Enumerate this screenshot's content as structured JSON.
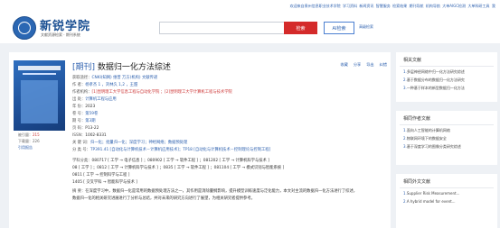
{
  "topnav": [
    "欢迎来自泉州信息职业技术学院",
    "学习资料",
    "新闻资讯",
    "智慧服务",
    "检索结果",
    "期刊导航",
    "机构导航",
    "大单AIGC检测",
    "大单科研工具",
    "我"
  ],
  "header": {
    "logo_title": "新锐学院",
    "logo_sub": "文献资源检索 · 期刊系统",
    "search_placeholder": "",
    "search_label": "检索",
    "ai_label": "AI检索",
    "advanced_label": "高级检索"
  },
  "article": {
    "type_tag": "[期刊]",
    "title": "数据归一化方法综述",
    "actions": [
      "收藏",
      "分享",
      "导出",
      "纠错"
    ],
    "rows": [
      {
        "label": "获取途径：",
        "value": "CNKI(知网)   维普   万方(机构)   文献传递"
      },
      {
        "label": "作 者：",
        "value": "杨孝杰 1 ，刘林久 1,2 ，王甜"
      },
      {
        "label": "作者机构：",
        "value": "[1]昆明理工大学信息工程与自动化学院 ；[2]昆明理工大学计算机工程与技术学院"
      },
      {
        "label": "出 处：",
        "value": "计算机工程与应用"
      },
      {
        "label": "年 份：",
        "value": "2023"
      },
      {
        "label": "卷 号：",
        "value": "第59卷"
      },
      {
        "label": "期 号：",
        "value": "第3期"
      },
      {
        "label": "页 码：",
        "value": "P13-22"
      },
      {
        "label": "ISSN：",
        "value": "1002-8331"
      },
      {
        "label": "关 键 词：",
        "value": "归一化；批量归一化；深度学习；神经网络；数据预处理"
      },
      {
        "label": "分 类 号：",
        "value": "TP391.41 [自动化与计算机技术－计算机应用技术]；TP18 [自动化与计算机技术－控制理论与控制工程]"
      },
      {
        "label": "学科分类：",
        "value": "080717 [ 工学 → 电子信息 ] ；080902 [ 工学 → 软件工程 ] ；081202 [ 工学 → 计算机科学与技术 ]"
      },
      {
        "label": "",
        "value": "08 [ 工学 ] ；0812 [ 工学 → 计算机科学与技术 ] ；0835 [ 工学 → 软件工程 ] ；081104 [ 工学 → 模式识别与智能系统 ]"
      },
      {
        "label": "",
        "value": "0811 [ 工学 → 控制科学与工程 ]"
      },
      {
        "label": "",
        "value": "1405 [ 交叉学科 → 智能科学与技术 ]"
      },
      {
        "label": "摘 要：",
        "value": "在深度学习中，数据归一化是常用的数据预处理方法之一，其作用是消除量纲影响，提升模型训练速度与泛化能力，本文对主流的数据归一化方法进行了综述，"
      },
      {
        "label": "",
        "value": "数据归一化的相关研究进展进行了分析与总结，并对未来的研究方向进行了展望，为相关研究者提供参考。"
      }
    ],
    "stats": {
      "downloads_label": "被引量：",
      "downloads": "215",
      "cited_label": "下载量：",
      "cited": "226",
      "more": "引用报告"
    }
  },
  "related": {
    "title": "相关文献",
    "items": [
      {
        "n": "1.",
        "text": "多层神经网络中归一化方法研究综述"
      },
      {
        "n": "2.",
        "text": "基于数据分布的数据归一化方法研究"
      },
      {
        "n": "3.",
        "text": "一种基于样本的新型数据归一化方法"
      }
    ]
  },
  "citing": {
    "title": "相同作者文献",
    "items": [
      {
        "n": "1.",
        "text": "面向人工智能的计算机网络"
      },
      {
        "n": "2.",
        "text": "物联网环境下的数据安全"
      },
      {
        "n": "3.",
        "text": "基于深度学习的图像分类研究综述"
      }
    ]
  },
  "cited": {
    "title": "相同外文文献",
    "items": [
      {
        "n": "1.",
        "text": "Supplier Risk Measurement..."
      },
      {
        "n": "2.",
        "text": "A hybrid model for event..."
      }
    ]
  }
}
